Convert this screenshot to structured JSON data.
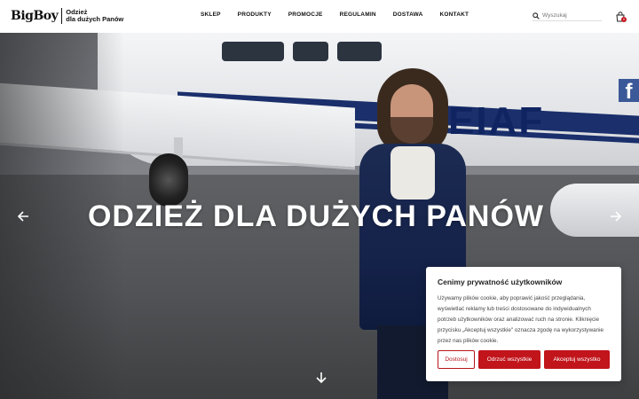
{
  "header": {
    "logo_mark": "BigBoy",
    "logo_tag_line1": "Odzież",
    "logo_tag_line2": "dla dużych Panów",
    "nav": [
      "SKLEP",
      "PRODUKTY",
      "PROMOCJE",
      "REGULAMIN",
      "DOSTAWA",
      "KONTAKT"
    ],
    "search_placeholder": "Wyszukaj",
    "cart_count": "0"
  },
  "hero": {
    "title": "ODZIEŻ DLA DUŻYCH PANÓW",
    "registration": "EIAF"
  },
  "social": {
    "facebook_letter": "f"
  },
  "cookie": {
    "title": "Cenimy prywatność użytkowników",
    "text": "Używamy plików cookie, aby poprawić jakość przeglądania, wyświetlać reklamy lub treści dostosowane do indywidualnych potrzeb użytkowników oraz analizować ruch na stronie. Kliknięcie przycisku „Akceptuj wszystkie\" oznacza zgodę na wykorzystywanie przez nas plików cookie.",
    "btn_customize": "Dostosuj",
    "btn_reject": "Odrzuć wszystkie",
    "btn_accept": "Akceptuj wszystko"
  },
  "colors": {
    "accent": "#c1141b",
    "facebook": "#3b5998",
    "text": "#111111"
  },
  "icons": [
    "search-icon",
    "cart-icon",
    "arrow-left-icon",
    "arrow-right-icon",
    "arrow-down-icon",
    "facebook-icon"
  ]
}
